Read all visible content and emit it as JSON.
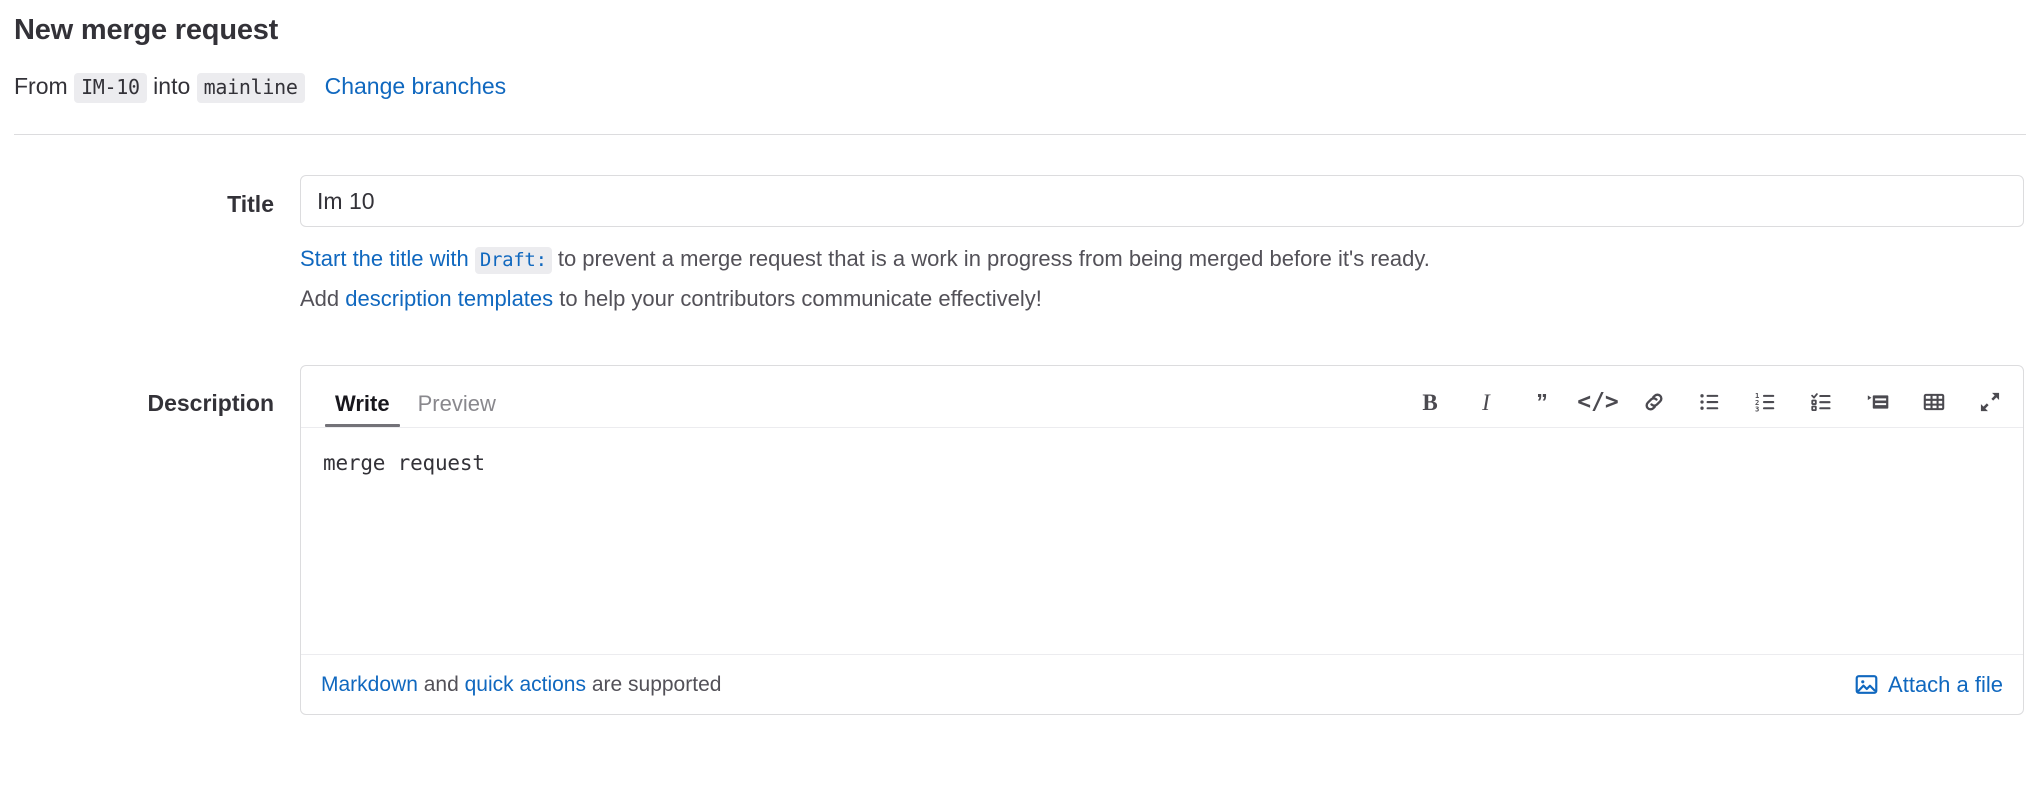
{
  "header": {
    "title": "New merge request",
    "from_label": "From ",
    "source_branch": "IM-10",
    "into_label": " into ",
    "target_branch": "mainline",
    "change_branches_link": "Change branches"
  },
  "title_field": {
    "label": "Title",
    "value": "Im 10",
    "placeholder": "",
    "hint1_link": "Start the title with",
    "hint1_code": "Draft:",
    "hint1_rest": " to prevent a merge request that is a work in progress from being merged before it's ready.",
    "hint2_prefix": "Add ",
    "hint2_link": "description templates",
    "hint2_rest": " to help your contributors communicate effectively!"
  },
  "description_field": {
    "label": "Description",
    "tabs": [
      {
        "label": "Write",
        "active": true
      },
      {
        "label": "Preview",
        "active": false
      }
    ],
    "toolbar": [
      {
        "name": "bold",
        "title": "Add bold text"
      },
      {
        "name": "italic",
        "title": "Add italic text"
      },
      {
        "name": "blockquote",
        "title": "Insert a quote"
      },
      {
        "name": "code",
        "title": "Insert code"
      },
      {
        "name": "link",
        "title": "Add a link"
      },
      {
        "name": "bullet-list",
        "title": "Add a bullet list"
      },
      {
        "name": "numbered-list",
        "title": "Add a numbered list"
      },
      {
        "name": "checklist",
        "title": "Add a checklist"
      },
      {
        "name": "collapsible-section",
        "title": "Add a collapsible section"
      },
      {
        "name": "table",
        "title": "Add a table"
      },
      {
        "name": "fullscreen",
        "title": "Go full screen"
      }
    ],
    "value": "merge request",
    "placeholder": "",
    "footer_markdown_link": "Markdown",
    "footer_and": " and ",
    "footer_quick_actions_link": "quick actions",
    "footer_suffix": " are supported",
    "attach_label": "Attach a file"
  },
  "colors": {
    "link": "#1068bf",
    "text": "#333238",
    "muted": "#535158",
    "border": "#dcdcde",
    "chip_bg": "#ececef"
  }
}
